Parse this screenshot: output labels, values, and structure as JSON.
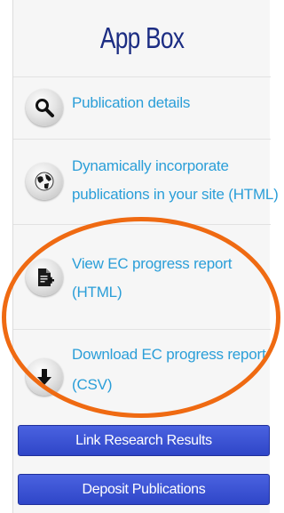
{
  "panel": {
    "title": "App Box",
    "items": [
      {
        "label_line1": "Publication details",
        "label_line2": "",
        "icon": "search-icon"
      },
      {
        "label_line1": "Dynamically incorporate",
        "label_line2": "publications in your site (HTML)",
        "icon": "globe-icon"
      },
      {
        "label_line1": "View EC progress report",
        "label_line2": "(HTML)",
        "icon": "document-add-icon"
      },
      {
        "label_line1": "Download EC progress report",
        "label_line2": "(CSV)",
        "icon": "download-arrow-icon"
      }
    ],
    "buttons": [
      {
        "label": "Link Research Results"
      },
      {
        "label": "Deposit Publications"
      }
    ]
  },
  "colors": {
    "title": "#1c2d83",
    "link": "#2a9ed8",
    "button": "#3a52d6",
    "highlight": "#ef6a12"
  }
}
